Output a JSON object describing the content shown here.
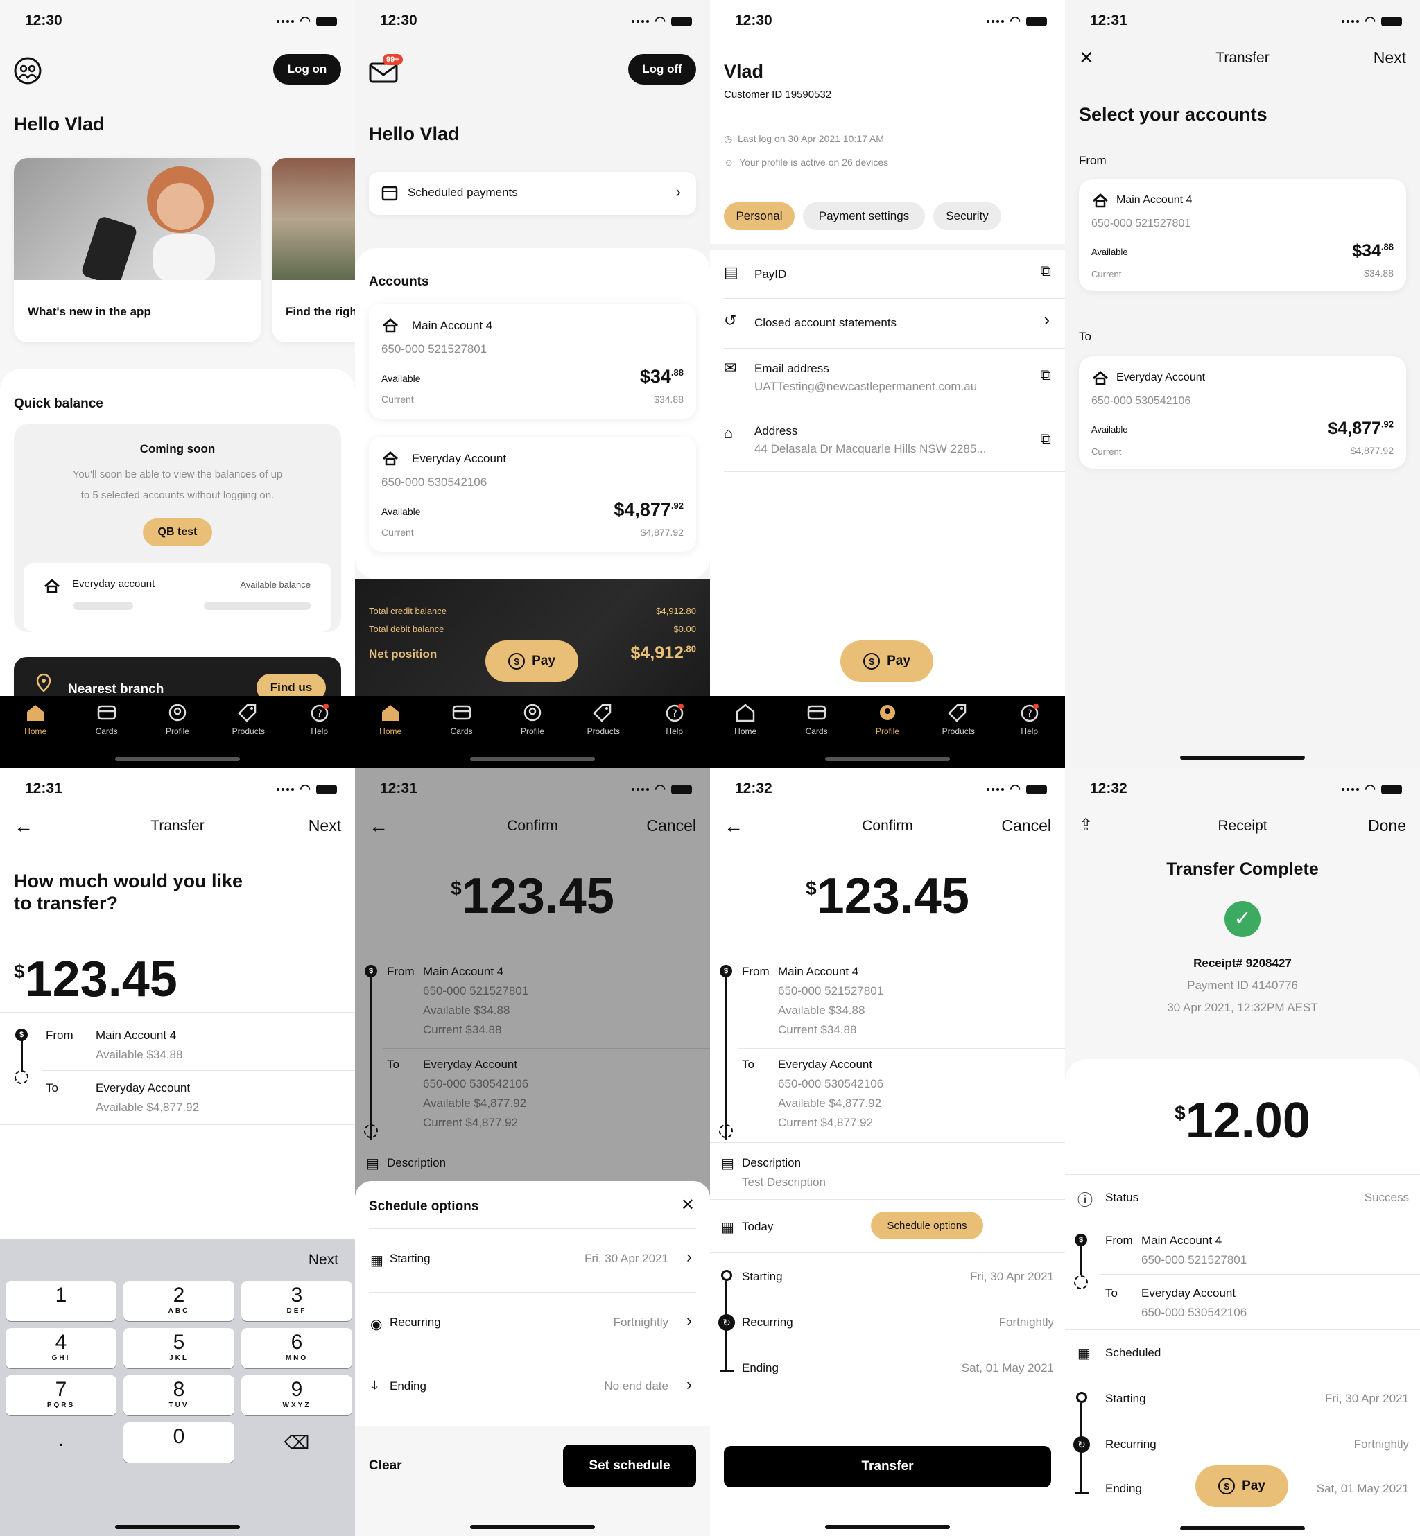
{
  "status": {
    "s1": "12:30",
    "s2": "12:30",
    "s3": "12:30",
    "s4": "12:31",
    "s5": "12:31",
    "s6": "12:31",
    "s7": "12:32",
    "s8": "12:32"
  },
  "tabs": {
    "home": "Home",
    "cards": "Cards",
    "profile": "Profile",
    "products": "Products",
    "help": "Help"
  },
  "s1": {
    "logon": "Log on",
    "hello": "Hello Vlad",
    "promo1": "What's new in the app",
    "promo2": "Find the righ",
    "quick_title": "Quick balance",
    "coming": "Coming soon",
    "coming_text1": "You'll soon be able to view the balances of up",
    "coming_text2": "to 5 selected accounts without logging on.",
    "qb_btn": "QB test",
    "acct": "Everyday account",
    "avail": "Available balance",
    "nearest": "Nearest branch",
    "find": "Find us"
  },
  "s2": {
    "badge": "99+",
    "logoff": "Log off",
    "hello": "Hello Vlad",
    "scheduled": "Scheduled payments",
    "accounts": "Accounts",
    "a1": {
      "name": "Main Account 4",
      "num": "650-000  521527801",
      "avail_l": "Available",
      "avail_d": "$34",
      "avail_c": ".88",
      "curr_l": "Current",
      "curr": "$34.88"
    },
    "a2": {
      "name": "Everyday Account",
      "num": "650-000  530542106",
      "avail_l": "Available",
      "avail_d": "$4,877",
      "avail_c": ".92",
      "curr_l": "Current",
      "curr": "$4,877.92"
    },
    "tc_l": "Total credit balance",
    "tc": "$4,912.80",
    "td_l": "Total debit balance",
    "td": "$0.00",
    "net_l": "Net position",
    "net_d": "$4,912",
    "net_c": ".80",
    "pay": "Pay"
  },
  "s3": {
    "name": "Vlad",
    "cid": "Customer ID 19590532",
    "last": "Last log on 30 Apr 2021 10:17 AM",
    "devices": "Your profile is active on 26 devices",
    "chip1": "Personal",
    "chip2": "Payment settings",
    "chip3": "Security",
    "payid": "PayID",
    "closed": "Closed account statements",
    "email_l": "Email address",
    "email": "UATTesting@newcastlepermanent.com.au",
    "addr_l": "Address",
    "addr": "44 Delasala Dr Macquarie Hills NSW 2285...",
    "pay": "Pay"
  },
  "s4": {
    "title": "Transfer",
    "next": "Next",
    "heading": "Select your accounts",
    "from": "From",
    "to": "To",
    "a1": {
      "name": "Main Account 4",
      "num": "650-000  521527801",
      "avail_l": "Available",
      "avail_d": "$34",
      "avail_c": ".88",
      "curr_l": "Current",
      "curr": "$34.88"
    },
    "a2": {
      "name": "Everyday Account",
      "num": "650-000  530542106",
      "avail_l": "Available",
      "avail_d": "$4,877",
      "avail_c": ".92",
      "curr_l": "Current",
      "curr": "$4,877.92"
    }
  },
  "s5": {
    "title": "Transfer",
    "next": "Next",
    "q1": "How much would you like",
    "q2": "to transfer?",
    "cur": "$",
    "amt": "123.45",
    "from": "From",
    "from_name": "Main Account 4",
    "from_av": "Available $34.88",
    "to": "To",
    "to_name": "Everyday Account",
    "to_av": "Available $4,877.92",
    "kb_next": "Next",
    "keys": [
      {
        "n": "1",
        "s": ""
      },
      {
        "n": "2",
        "s": "ABC"
      },
      {
        "n": "3",
        "s": "DEF"
      },
      {
        "n": "4",
        "s": "GHI"
      },
      {
        "n": "5",
        "s": "JKL"
      },
      {
        "n": "6",
        "s": "MNO"
      },
      {
        "n": "7",
        "s": "PQRS"
      },
      {
        "n": "8",
        "s": "TUV"
      },
      {
        "n": "9",
        "s": "WXYZ"
      }
    ],
    "dot": ".",
    "zero": "0"
  },
  "s6": {
    "title": "Confirm",
    "cancel": "Cancel",
    "cur": "$",
    "amt": "123.45",
    "from": "From",
    "from_name": "Main Account 4",
    "from_num": "650-000 521527801",
    "from_av": "Available $34.88",
    "from_cur": "Current $34.88",
    "to": "To",
    "to_name": "Everyday Account",
    "to_num": "650-000 530542106",
    "to_av": "Available $4,877.92",
    "to_cur": "Current $4,877.92",
    "desc": "Description",
    "sheet_title": "Schedule options",
    "starting": "Starting",
    "starting_v": "Fri, 30 Apr 2021",
    "recurring": "Recurring",
    "recurring_v": "Fortnightly",
    "ending": "Ending",
    "ending_v": "No end date",
    "clear": "Clear",
    "set": "Set schedule"
  },
  "s7": {
    "title": "Confirm",
    "cancel": "Cancel",
    "cur": "$",
    "amt": "123.45",
    "from": "From",
    "from_name": "Main Account 4",
    "from_num": "650-000 521527801",
    "from_av": "Available $34.88",
    "from_cur": "Current $34.88",
    "to": "To",
    "to_name": "Everyday Account",
    "to_num": "650-000 530542106",
    "to_av": "Available $4,877.92",
    "to_cur": "Current $4,877.92",
    "desc": "Description",
    "desc_v": "Test Description",
    "today": "Today",
    "sched_btn": "Schedule options",
    "starting": "Starting",
    "starting_v": "Fri, 30 Apr 2021",
    "recurring": "Recurring",
    "recurring_v": "Fortnightly",
    "ending": "Ending",
    "ending_v": "Sat, 01 May 2021",
    "transfer": "Transfer"
  },
  "s8": {
    "title": "Receipt",
    "done": "Done",
    "heading": "Transfer Complete",
    "receipt": "Receipt# 9208427",
    "payid": "Payment ID 4140776",
    "date": "30 Apr 2021, 12:32PM AEST",
    "cur": "$",
    "amt": "12.00",
    "status_l": "Status",
    "status_v": "Success",
    "from": "From",
    "from_name": "Main Account 4",
    "from_num": "650-000 521527801",
    "to": "To",
    "to_name": "Everyday Account",
    "to_num": "650-000 530542106",
    "scheduled": "Scheduled",
    "starting": "Starting",
    "starting_v": "Fri, 30 Apr 2021",
    "recurring": "Recurring",
    "recurring_v": "Fortnightly",
    "ending": "Ending",
    "ending_v": "Sat, 01 May 2021",
    "pay": "Pay"
  },
  "colors": {
    "gold": "#e9bf78",
    "dark": "#000000",
    "success": "#3daa62",
    "badge": "#e8442f"
  }
}
